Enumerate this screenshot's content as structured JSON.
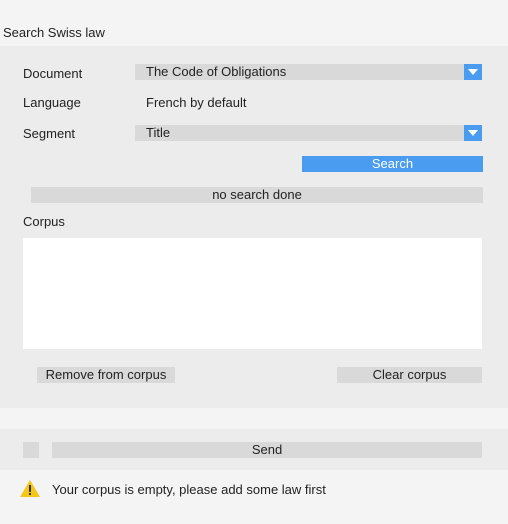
{
  "window": {
    "title": "Search Swiss law"
  },
  "form": {
    "document_label": "Document",
    "document_value": "The Code of Obligations",
    "language_label": "Language",
    "language_value": "French by default",
    "segment_label": "Segment",
    "segment_value": "Title",
    "search_button": "Search",
    "status_text": "no search done",
    "corpus_label": "Corpus",
    "remove_button": "Remove from corpus",
    "clear_button": "Clear corpus"
  },
  "footer": {
    "send_button": "Send",
    "warning_text": "Your corpus is empty, please add some law first"
  },
  "colors": {
    "accent": "#4a9cf0",
    "warning": "#f5c518"
  }
}
